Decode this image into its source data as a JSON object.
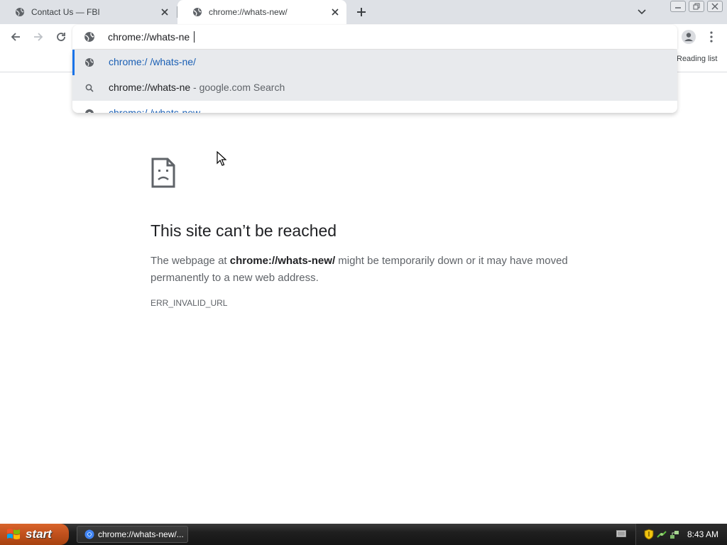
{
  "tabs": [
    {
      "title": "Contact Us — FBI",
      "active": false
    },
    {
      "title": "chrome://whats-new/",
      "active": true
    }
  ],
  "omnibox": {
    "value": "chrome://whats-ne"
  },
  "bookmarks_bar": {
    "reading_list_label": "Reading list"
  },
  "suggestions": [
    {
      "text": "chrome:/ /whats-ne/",
      "icon": "globe-icon"
    },
    {
      "text": "chrome://whats-ne",
      "suffix": " - google.com Search",
      "icon": "search-icon"
    },
    {
      "text": "chrome:/ /whats-new",
      "icon": "chrome-icon"
    }
  ],
  "error_page": {
    "title": "This site can’t be reached",
    "body_prefix": "The webpage at ",
    "url": "chrome://whats-new/",
    "body_suffix": " might be temporarily down or it may have moved permanently to a new web address.",
    "code": "ERR_INVALID_URL"
  },
  "taskbar": {
    "start_label": "start",
    "window_label": "chrome://whats-new/...",
    "clock": "8:43 AM"
  },
  "colors": {
    "accent": "#1a73e8",
    "link_text": "#1a5fb4",
    "start_button": "#c0501d"
  }
}
